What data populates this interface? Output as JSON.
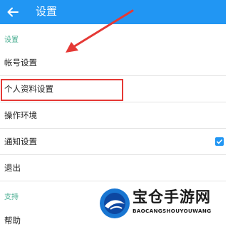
{
  "appbar": {
    "title": "设置",
    "back_icon": "arrow-left-icon"
  },
  "sections": [
    {
      "header": "设置"
    },
    {
      "header": "支持"
    }
  ],
  "rows": {
    "account": "帐号设置",
    "profile": "个人资料设置",
    "operation": "操作环境",
    "notification": "通知设置",
    "logout": "退出",
    "help": "帮助"
  },
  "notification_checked": true,
  "colors": {
    "primary": "#2196f3",
    "section_header": "#4caf93",
    "annotation": "#e53935"
  },
  "watermark": {
    "title": "宝仓手游网",
    "subtitle": "BAOCANGSHOUYOUWANG"
  }
}
